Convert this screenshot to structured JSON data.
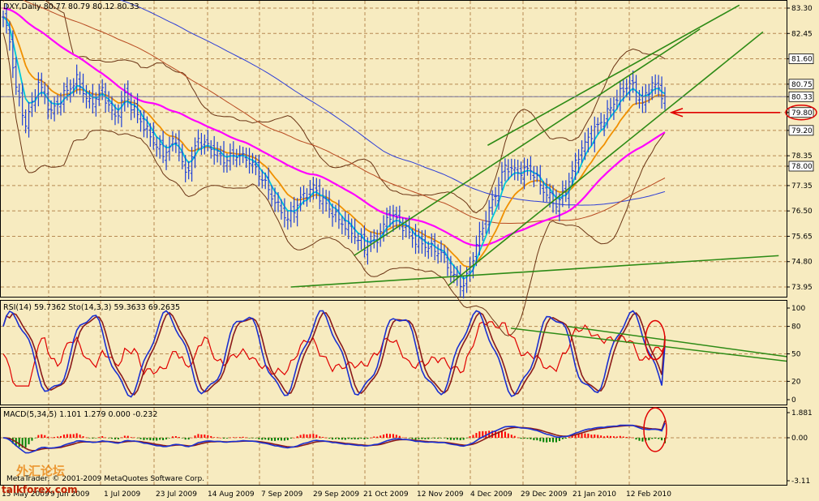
{
  "window": {
    "main_header": "DXY,Daily  80.77 80.79 80.12 80.33",
    "rsi_header": "RSI(14) 59.7362  Sto(14,3,3) 59.3633 69.2635",
    "macd_header": "MACD(5,34,5) 1.101 1.279 0.000 -0.232",
    "copyright": "MetaTrader, © 2001-2009 MetaQuotes Software Corp.",
    "watermark_cn": "外汇论坛",
    "watermark_site": "talkforex.com"
  },
  "colors": {
    "background": "#f7ebc0",
    "candles": "#1e3fd6",
    "ema_fast": "#00c8d8",
    "ema_mid": "#f09000",
    "sma_pink": "#ff00ff",
    "sma_long": "#2f3fd6",
    "sma_brown": "#b84a20",
    "envelope": "#6b3414",
    "channel": "#2e8b16",
    "arrow": "#e00000",
    "rsi": "#e00000",
    "sto_main": "#1a2fd0",
    "sto_signal": "#8b1a1a",
    "macd_pos": "#ff0000",
    "macd_neg": "#008000",
    "grid": "#b78a52"
  },
  "chart_data": [
    {
      "type": "candlestick",
      "title": "DXY,Daily",
      "ohlc_last": {
        "open": 80.77,
        "high": 80.79,
        "low": 80.12,
        "close": 80.33
      },
      "y_ticks": [
        "83.30",
        "82.45",
        "81.60",
        "80.75",
        "80.33",
        "79.80",
        "79.20",
        "78.35",
        "78.00",
        "77.35",
        "76.50",
        "75.65",
        "74.80",
        "73.95"
      ],
      "price_tags": [
        {
          "label": "81.60",
          "style": "white"
        },
        {
          "label": "80.75",
          "style": "white"
        },
        {
          "label": "80.33",
          "style": "white"
        },
        {
          "label": "79.80",
          "style": "circled"
        },
        {
          "label": "79.20",
          "style": "white"
        },
        {
          "label": "78.00",
          "style": "white"
        }
      ],
      "x_ticks": [
        "15 May 2009",
        "9 Jun 2009",
        "1 Jul 2009",
        "23 Jul 2009",
        "14 Aug 2009",
        "7 Sep 2009",
        "29 Sep 2009",
        "21 Oct 2009",
        "12 Nov 2009",
        "4 Dec 2009",
        "29 Dec 2009",
        "21 Jan 2010",
        "12 Feb 2010"
      ],
      "anchors": [
        [
          0,
          83.0
        ],
        [
          2,
          82.2
        ],
        [
          4,
          80.6
        ],
        [
          7,
          79.4
        ],
        [
          11,
          80.8
        ],
        [
          15,
          79.8
        ],
        [
          19,
          80.4
        ],
        [
          23,
          80.9
        ],
        [
          27,
          80.1
        ],
        [
          31,
          80.5
        ],
        [
          35,
          79.6
        ],
        [
          38,
          80.4
        ],
        [
          42,
          79.7
        ],
        [
          46,
          79.0
        ],
        [
          50,
          78.4
        ],
        [
          54,
          78.9
        ],
        [
          57,
          77.7
        ],
        [
          61,
          78.9
        ],
        [
          65,
          78.6
        ],
        [
          69,
          78.2
        ],
        [
          73,
          78.4
        ],
        [
          77,
          78.2
        ],
        [
          81,
          77.6
        ],
        [
          85,
          76.8
        ],
        [
          89,
          76.2
        ],
        [
          93,
          76.9
        ],
        [
          97,
          77.3
        ],
        [
          101,
          76.7
        ],
        [
          105,
          76.2
        ],
        [
          109,
          75.8
        ],
        [
          113,
          75.3
        ],
        [
          117,
          75.6
        ],
        [
          121,
          76.4
        ],
        [
          125,
          76.0
        ],
        [
          129,
          75.5
        ],
        [
          133,
          75.3
        ],
        [
          137,
          75.1
        ],
        [
          141,
          74.3
        ],
        [
          144,
          74.0
        ],
        [
          146,
          74.6
        ],
        [
          149,
          75.7
        ],
        [
          153,
          76.8
        ],
        [
          157,
          78.0
        ],
        [
          161,
          77.8
        ],
        [
          165,
          77.9
        ],
        [
          169,
          77.2
        ],
        [
          173,
          76.7
        ],
        [
          176,
          77.2
        ],
        [
          180,
          78.4
        ],
        [
          184,
          79.1
        ],
        [
          188,
          79.6
        ],
        [
          192,
          80.3
        ],
        [
          196,
          80.8
        ],
        [
          200,
          80.1
        ],
        [
          203,
          80.8
        ],
        [
          207,
          80.3
        ]
      ],
      "channel_lines": [
        [
          [
            0.45,
            75.0
          ],
          [
            0.89,
            82.6
          ]
        ],
        [
          [
            0.57,
            74.0
          ],
          [
            0.97,
            82.5
          ]
        ],
        [
          [
            0.62,
            78.7
          ],
          [
            0.94,
            83.4
          ]
        ],
        [
          [
            0.37,
            73.95
          ],
          [
            0.99,
            75.0
          ]
        ]
      ]
    },
    {
      "type": "line",
      "title": "RSI(14) 59.7362  Sto(14,3,3) 59.3633 69.2635",
      "y_ticks": [
        "100",
        "80",
        "50",
        "20",
        "0"
      ],
      "ylim": [
        0,
        100
      ],
      "last_values": {
        "rsi": 59.7362,
        "sto_main": 59.3633,
        "sto_signal": 69.2635
      }
    },
    {
      "type": "bar",
      "title": "MACD(5,34,5) 1.101 1.279 0.000 -0.232",
      "y_ticks": [
        "1.881",
        "0.00",
        "-3.11"
      ],
      "last_values": {
        "macd": 1.101,
        "signal": 1.279
      }
    }
  ]
}
